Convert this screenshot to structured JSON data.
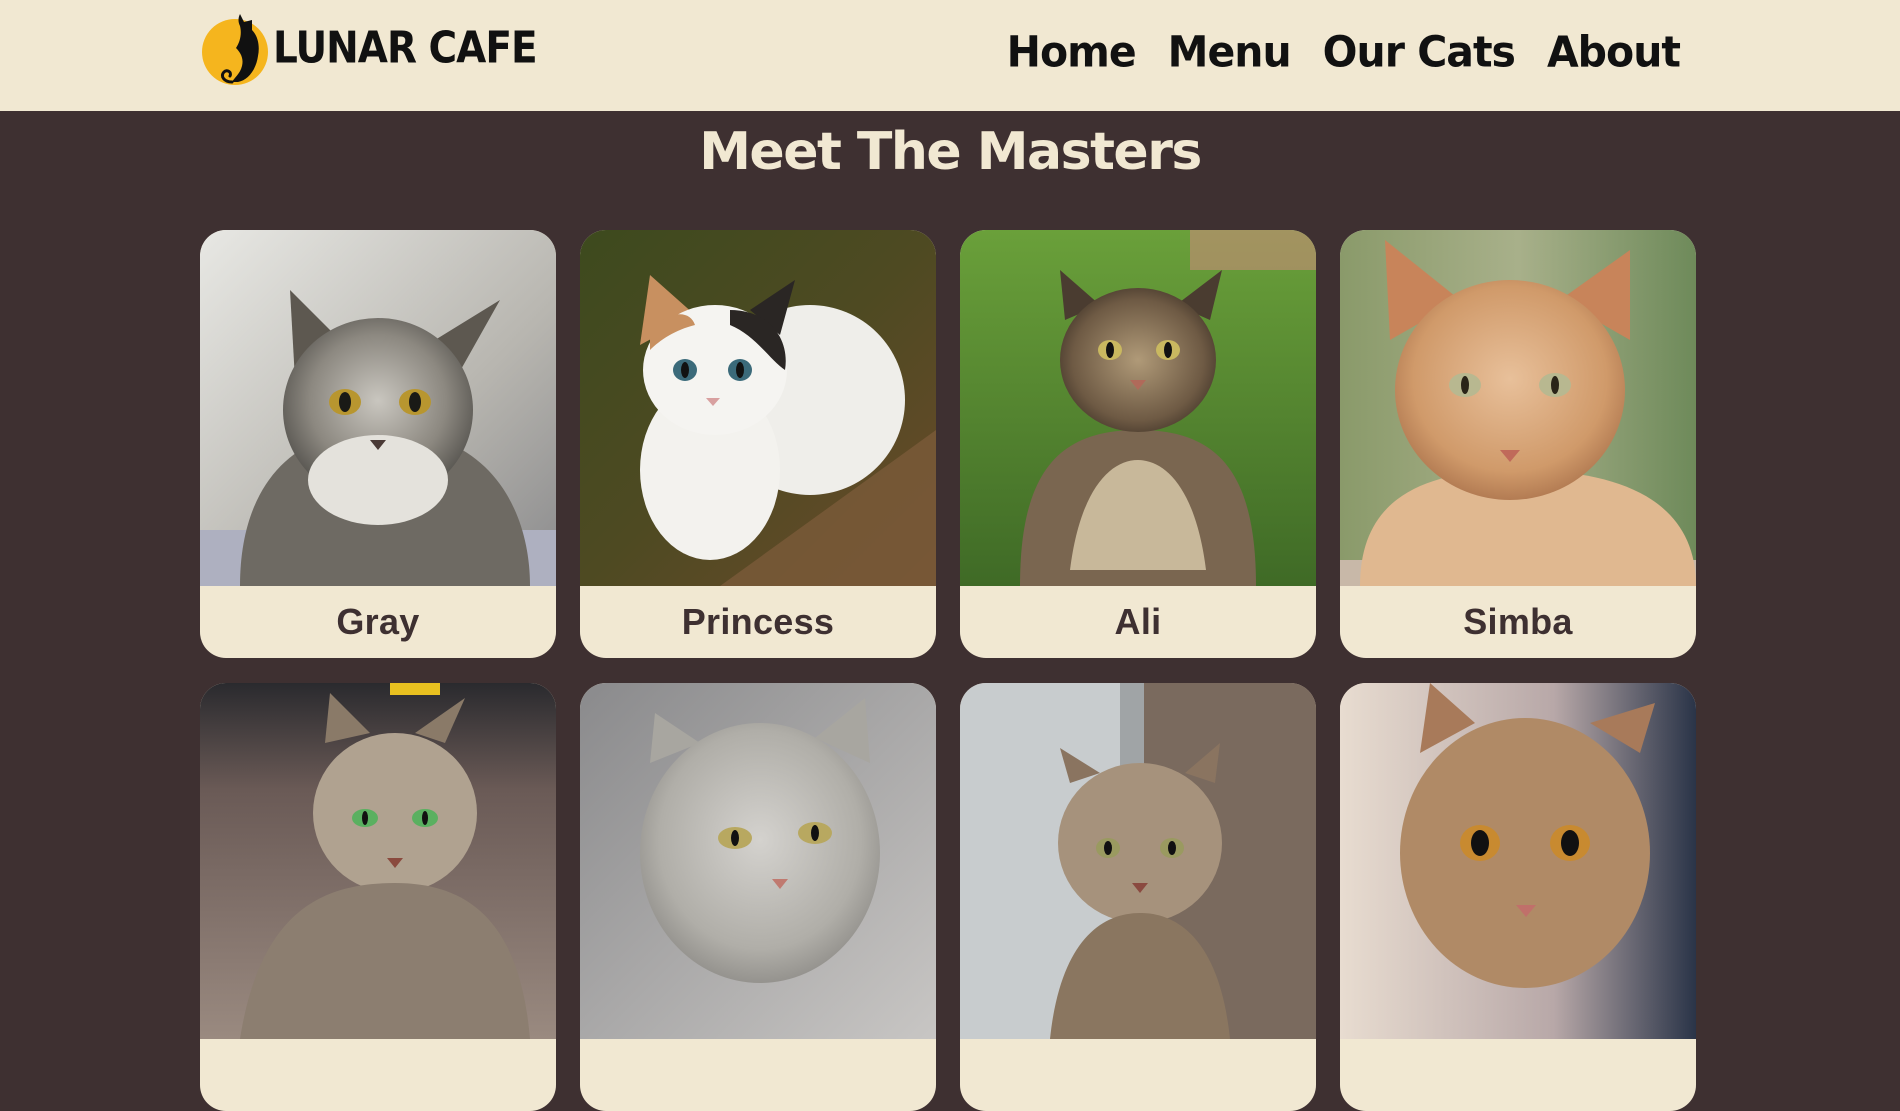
{
  "brand": {
    "name": "LUNAR CAFE",
    "logo_icon": "cat-moon-icon",
    "accent_color": "#f5b51e"
  },
  "nav": {
    "items": [
      {
        "label": "Home"
      },
      {
        "label": "Menu"
      },
      {
        "label": "Our Cats"
      },
      {
        "label": "About"
      }
    ]
  },
  "main": {
    "title": "Meet The Masters"
  },
  "colors": {
    "background": "#3e3031",
    "cream": "#f1e8d2",
    "text_dark": "#111111"
  },
  "cats": [
    {
      "name": "Gray",
      "photo": "gray-tabby-cat-photo"
    },
    {
      "name": "Princess",
      "photo": "calico-cat-photo"
    },
    {
      "name": "Ali",
      "photo": "maine-coon-cat-photo"
    },
    {
      "name": "Simba",
      "photo": "orange-cat-photo"
    },
    {
      "name": "",
      "photo": "green-eyed-tabby-cat-photo"
    },
    {
      "name": "",
      "photo": "silver-cat-photo"
    },
    {
      "name": "",
      "photo": "tabby-kitten-photo"
    },
    {
      "name": "",
      "photo": "brown-tabby-cat-photo"
    }
  ]
}
